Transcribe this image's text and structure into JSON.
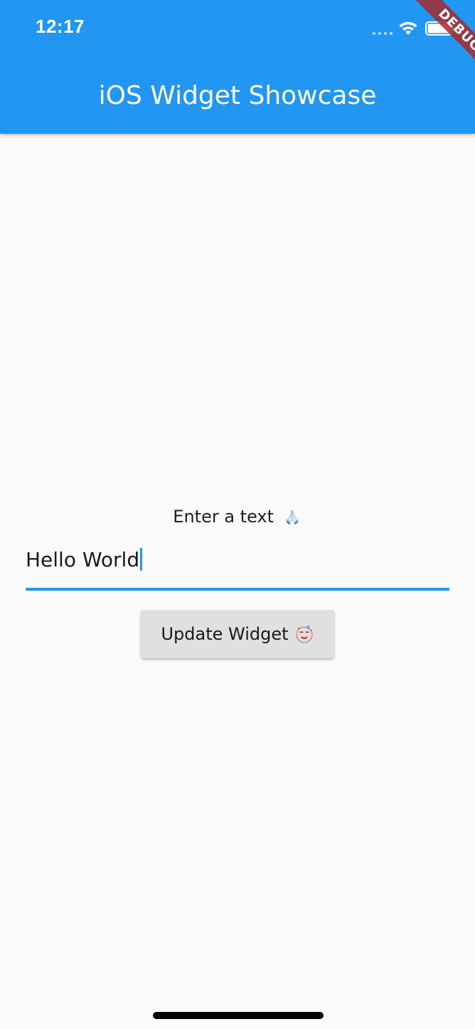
{
  "status_bar": {
    "time": "12:17"
  },
  "app_bar": {
    "title": "iOS Widget Showcase",
    "debug_banner": "DEBUG"
  },
  "form": {
    "prompt_label": "Enter a text",
    "prompt_emoji_icon": "folded-hands-icon",
    "input_value": "Hello World",
    "button_label": "Update Widget",
    "button_emoji_icon": "partying-face-icon"
  },
  "colors": {
    "primary": "#2196f3",
    "background": "#fafafa",
    "button": "#e0e0e0",
    "debug": "#a52a2a"
  }
}
